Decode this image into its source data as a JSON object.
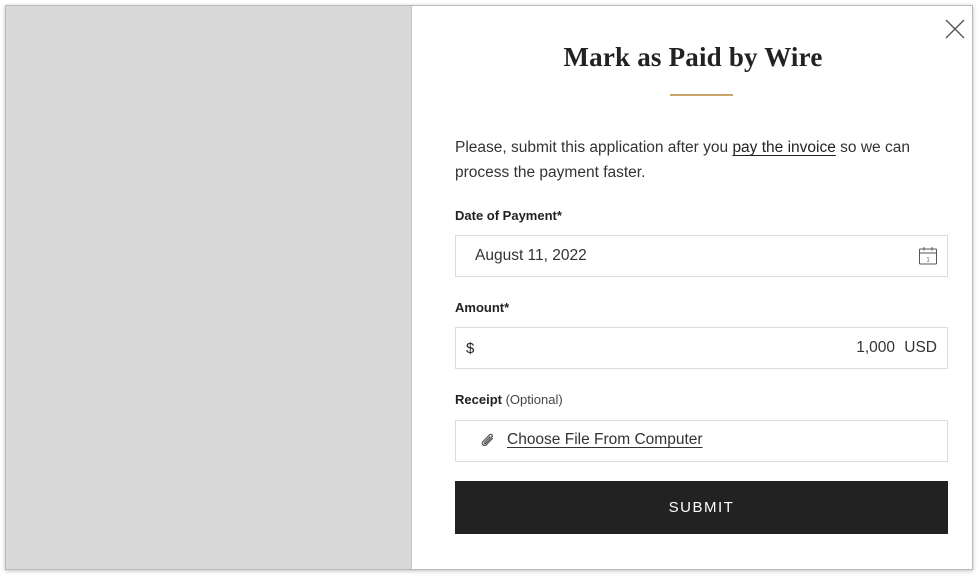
{
  "modal": {
    "title": "Mark as Paid by Wire",
    "intro_before": "Please, submit this application after you ",
    "intro_link": "pay the invoice",
    "intro_after": " so we can process the payment faster."
  },
  "date_field": {
    "label": "Date of Payment*",
    "value": "August 11, 2022",
    "icon": "calendar-icon",
    "calendar_day": "1"
  },
  "amount_field": {
    "label": "Amount*",
    "currency_symbol": "$",
    "value": "1,000",
    "currency_code": "USD"
  },
  "receipt_field": {
    "label": "Receipt",
    "optional": "(Optional)",
    "action": "Choose File From Computer",
    "icon": "paperclip-icon"
  },
  "submit": {
    "label": "SUBMIT"
  },
  "colors": {
    "accent": "#c6a46a",
    "button_bg": "#222222",
    "backdrop": "#d8d8d8"
  }
}
